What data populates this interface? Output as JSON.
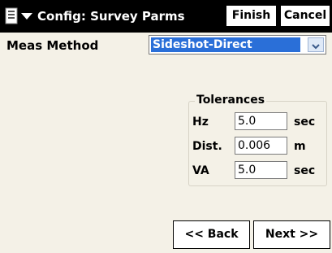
{
  "titlebar": {
    "menu_icon": "menu-dropdown-icon",
    "title": "Config: Survey Parms",
    "finish_label": "Finish",
    "cancel_label": "Cancel"
  },
  "meas_method": {
    "label": "Meas Method",
    "selected": "Sideshot-Direct"
  },
  "tolerances": {
    "title": "Tolerances",
    "fields": [
      {
        "label": "Hz",
        "value": "5.0",
        "unit": "sec"
      },
      {
        "label": "Dist.",
        "value": "0.006",
        "unit": "m"
      },
      {
        "label": "VA",
        "value": "5.0",
        "unit": "sec"
      }
    ]
  },
  "nav": {
    "back_label": "<< Back",
    "next_label": "Next >>"
  },
  "colors": {
    "titlebar_bg": "#000000",
    "selection_bg": "#2a6fd8",
    "page_bg": "#f4f1e7"
  }
}
